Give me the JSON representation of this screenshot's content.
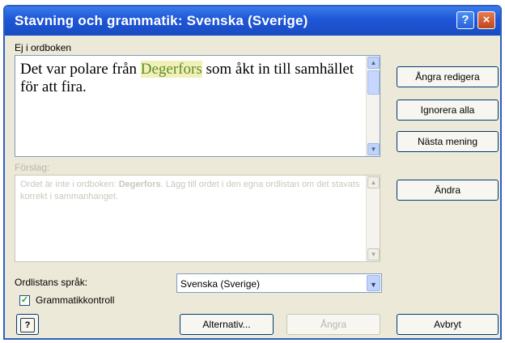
{
  "window": {
    "title": "Stavning och grammatik: Svenska (Sverige)",
    "help_glyph": "?",
    "close_glyph": "×"
  },
  "main": {
    "label": "Ej i ordboken",
    "text_before": "Det var polare från ",
    "text_highlight": "Degerfors",
    "text_after": " som åkt in till samhället för att fira."
  },
  "suggestions": {
    "label": "Förslag:",
    "text_before": "Ordet är inte i ordboken: ",
    "text_bold": "Degerfors",
    "text_after": ". Lägg till ordet i den egna ordlistan om det stavats korrekt i sammanhanget."
  },
  "buttons": {
    "undo_edit": "Ångra redigera",
    "ignore_all": "Ignorera alla",
    "next_sentence": "Nästa mening",
    "change": "Ändra",
    "options": "Alternativ...",
    "undo": "Ångra",
    "cancel": "Avbryt"
  },
  "language": {
    "label": "Ordlistans språk:",
    "selected": "Svenska (Sverige)"
  },
  "grammar_check": {
    "label": "Grammatikkontroll",
    "checked": true
  },
  "icons": {
    "help": "help-icon",
    "close": "close-icon",
    "dropdown": "chevron-down-icon",
    "scroll_up": "chevron-up-icon",
    "scroll_down": "chevron-down-icon"
  }
}
